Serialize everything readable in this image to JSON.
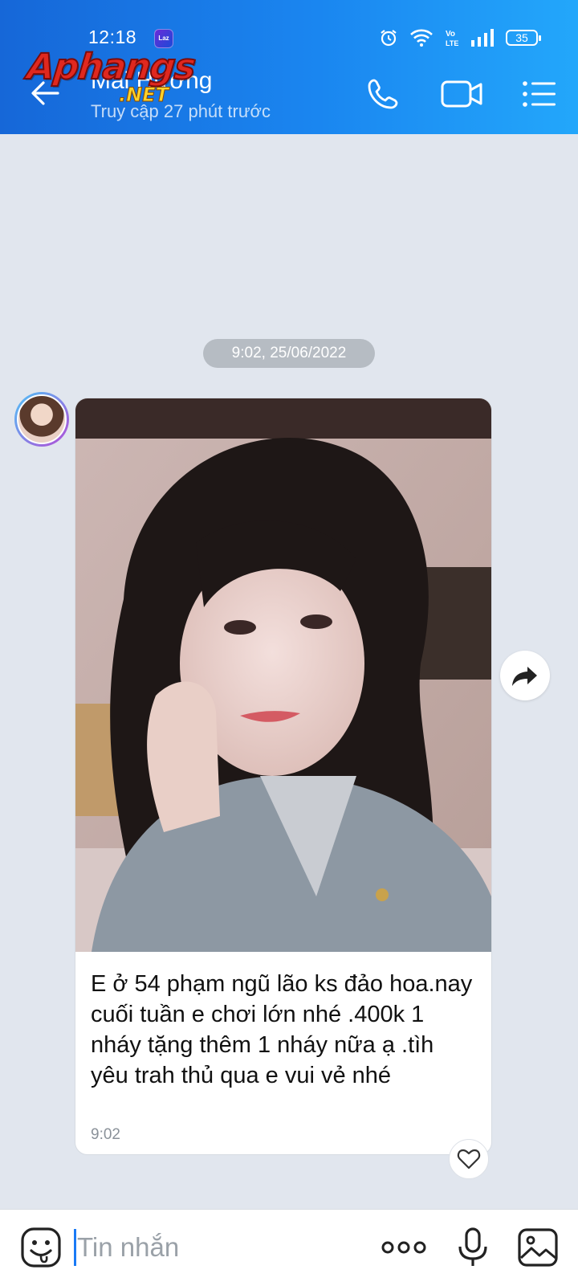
{
  "status_bar": {
    "time": "12:18",
    "app_badge_label": "Laz",
    "battery": "35",
    "icons": [
      "alarm-icon",
      "wifi-icon",
      "volte-icon",
      "signal-icon",
      "battery-icon"
    ]
  },
  "watermark": {
    "main": "Aphangs",
    "sub": ".NET"
  },
  "header": {
    "contact_name": "Mai Hương",
    "last_seen": "Truy cập 27 phút trước",
    "icons": [
      "back-arrow-icon",
      "phone-icon",
      "video-call-icon",
      "menu-list-icon"
    ]
  },
  "chat": {
    "date_separator": "9:02, 25/06/2022",
    "message": {
      "text": "E ở 54 phạm ngũ lão ks đảo hoa.nay cuối tuần e chơi lớn nhé .400k 1 nháy tặng thêm 1 nháy nữa ạ .tìh yêu trah thủ qua e vui vẻ nhé",
      "time": "9:02",
      "has_photo": true
    }
  },
  "input_bar": {
    "placeholder": "Tin nhắn",
    "value": "",
    "icons": [
      "sticker-icon",
      "more-options-icon",
      "microphone-icon",
      "image-icon"
    ]
  },
  "colors": {
    "header_start": "#1667d8",
    "header_end": "#23a7fb",
    "chat_background": "#e1e6ee",
    "accent": "#1a7af5"
  }
}
